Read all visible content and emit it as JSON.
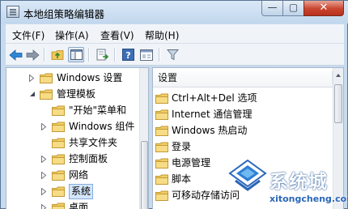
{
  "window": {
    "title": "本地组策略编辑器"
  },
  "window_controls": {
    "minimize": "—",
    "maximize": "▢",
    "close": "✕"
  },
  "menu": [
    "文件(F)",
    "操作(A)",
    "查看(V)",
    "帮助(H)"
  ],
  "toolbar": {
    "buttons": [
      "back-icon",
      "forward-icon",
      "up-folder-icon",
      "show-hide-tree-icon",
      "export-list-icon",
      "help-icon",
      "properties-icon",
      "filter-icon"
    ],
    "active": "show-hide-tree-icon"
  },
  "tree": {
    "items": [
      {
        "label": "Windows 设置",
        "expander": "collapsed"
      },
      {
        "label": "管理模板",
        "expander": "expanded"
      },
      {
        "label": "\"开始\"菜单和",
        "expander": "none"
      },
      {
        "label": "Windows 组件",
        "expander": "collapsed"
      },
      {
        "label": "共享文件夹",
        "expander": "none"
      },
      {
        "label": "控制面板",
        "expander": "collapsed"
      },
      {
        "label": "网络",
        "expander": "collapsed"
      },
      {
        "label": "系统",
        "expander": "collapsed",
        "selected": true
      },
      {
        "label": "桌面",
        "expander": "collapsed"
      }
    ]
  },
  "list": {
    "column": "设置",
    "items": [
      "Ctrl+Alt+Del 选项",
      "Internet 通信管理",
      "Windows 热启动",
      "登录",
      "电源管理",
      "脚本",
      "可移动存储访问"
    ]
  },
  "watermark": {
    "name": "系统城",
    "url": "xitongcheng.com"
  },
  "colors": {
    "selection": "#d4e6fa",
    "folder": "#f2cd63",
    "accent": "#2a67b8"
  }
}
